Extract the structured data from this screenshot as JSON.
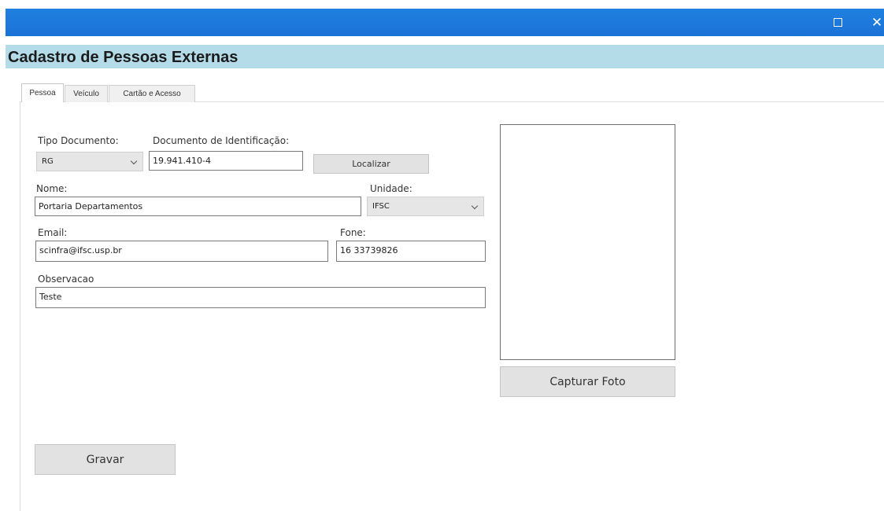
{
  "window": {
    "maximize_icon": "maximize-icon",
    "close_icon": "close-icon",
    "close_glyph": "✕"
  },
  "header": {
    "title": "Cadastro de Pessoas Externas"
  },
  "tabs": [
    {
      "label": "Pessoa",
      "active": true
    },
    {
      "label": "Veículo",
      "active": false
    },
    {
      "label": "Cartão e Acesso",
      "active": false
    }
  ],
  "form": {
    "tipo_documento": {
      "label": "Tipo Documento:",
      "value": "RG"
    },
    "documento": {
      "label": "Documento de Identificação:",
      "value": "19.941.410-4"
    },
    "localizar_label": "Localizar",
    "nome": {
      "label": "Nome:",
      "value": "Portaria Departamentos"
    },
    "unidade": {
      "label": "Unidade:",
      "value": "IFSC"
    },
    "email": {
      "label": "Email:",
      "value": "scinfra@ifsc.usp.br"
    },
    "fone": {
      "label": "Fone:",
      "value": "16 33739826"
    },
    "observacao": {
      "label": "Observacao",
      "value": "Teste"
    },
    "gravar_label": "Gravar"
  },
  "photo": {
    "capturar_label": "Capturar Foto"
  },
  "colors": {
    "titlebar": "#1a73d6",
    "header_band": "#b4dbe8",
    "button_bg": "#e2e2e2"
  }
}
